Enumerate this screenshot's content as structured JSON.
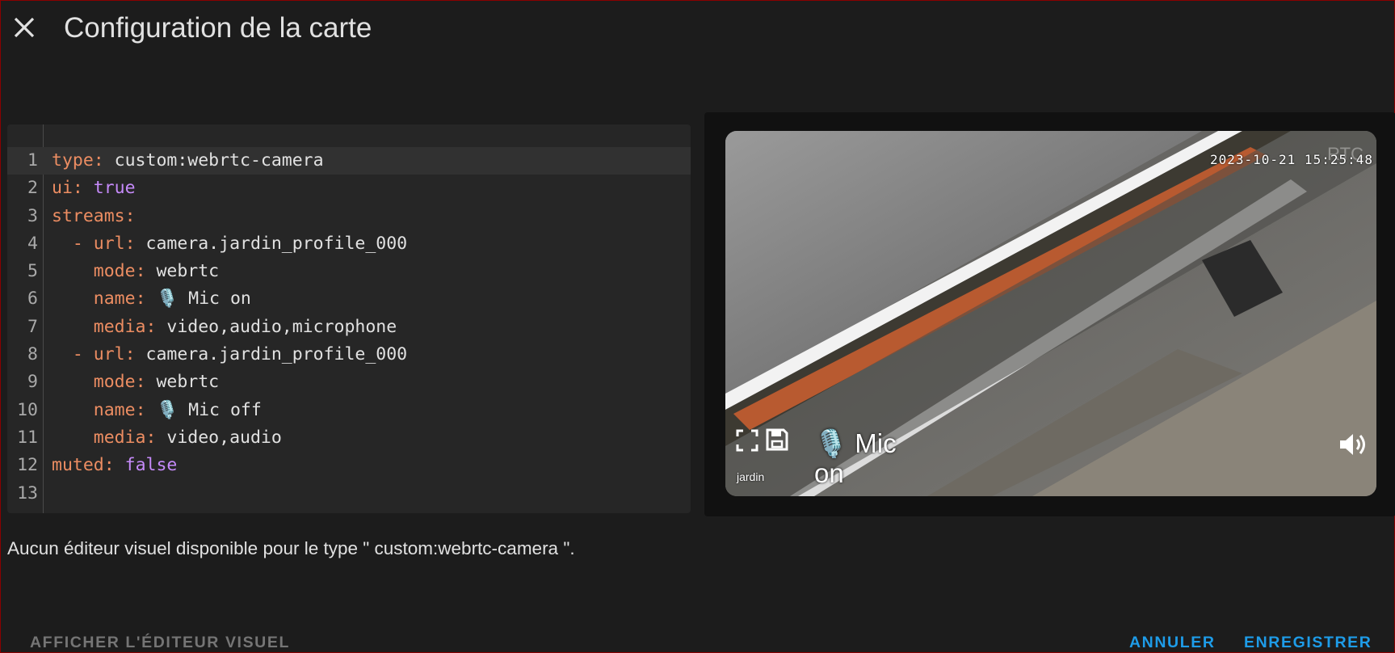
{
  "dialog": {
    "title": "Configuration de la carte"
  },
  "editor": {
    "lines": [
      {
        "num": "1",
        "indent": "",
        "dash": "",
        "key": "type",
        "sep": ": ",
        "value": "custom:webrtc-camera",
        "vtype": "plain"
      },
      {
        "num": "2",
        "indent": "",
        "dash": "",
        "key": "ui",
        "sep": ": ",
        "value": "true",
        "vtype": "bool"
      },
      {
        "num": "3",
        "indent": "",
        "dash": "",
        "key": "streams",
        "sep": ":",
        "value": "",
        "vtype": "plain"
      },
      {
        "num": "4",
        "indent": "  ",
        "dash": "- ",
        "key": "url",
        "sep": ": ",
        "value": "camera.jardin_profile_000",
        "vtype": "plain"
      },
      {
        "num": "5",
        "indent": "    ",
        "dash": "",
        "key": "mode",
        "sep": ": ",
        "value": "webrtc",
        "vtype": "plain"
      },
      {
        "num": "6",
        "indent": "    ",
        "dash": "",
        "key": "name",
        "sep": ": ",
        "value": "🎙️ Mic on",
        "vtype": "plain"
      },
      {
        "num": "7",
        "indent": "    ",
        "dash": "",
        "key": "media",
        "sep": ": ",
        "value": "video,audio,microphone",
        "vtype": "plain"
      },
      {
        "num": "8",
        "indent": "  ",
        "dash": "- ",
        "key": "url",
        "sep": ": ",
        "value": "camera.jardin_profile_000",
        "vtype": "plain"
      },
      {
        "num": "9",
        "indent": "    ",
        "dash": "",
        "key": "mode",
        "sep": ": ",
        "value": "webrtc",
        "vtype": "plain"
      },
      {
        "num": "10",
        "indent": "    ",
        "dash": "",
        "key": "name",
        "sep": ": ",
        "value": "🎙️ Mic off",
        "vtype": "plain"
      },
      {
        "num": "11",
        "indent": "    ",
        "dash": "",
        "key": "media",
        "sep": ": ",
        "value": "video,audio",
        "vtype": "plain"
      },
      {
        "num": "12",
        "indent": "",
        "dash": "",
        "key": "muted",
        "sep": ": ",
        "value": "false",
        "vtype": "bool"
      },
      {
        "num": "13",
        "indent": "",
        "dash": "",
        "key": "",
        "sep": "",
        "value": "",
        "vtype": "plain"
      }
    ]
  },
  "preview": {
    "rtc_label": "RTC",
    "timestamp": "2023-10-21 15:25:48",
    "stream_label": "🎙️ Mic on",
    "camera_name": "jardin",
    "icons": [
      "fullscreen-icon",
      "save-icon",
      "volume-icon"
    ]
  },
  "message": "Aucun éditeur visuel disponible pour le type \" custom:webrtc-camera \".",
  "footer": {
    "show_visual_editor": "AFFICHER L'ÉDITEUR VISUEL",
    "cancel": "ANNULER",
    "save": "ENREGISTRER"
  },
  "colors": {
    "accent": "#1e9ce8",
    "yaml_key": "#ec8d62",
    "yaml_bool": "#c58af9",
    "background": "#1c1c1c"
  }
}
